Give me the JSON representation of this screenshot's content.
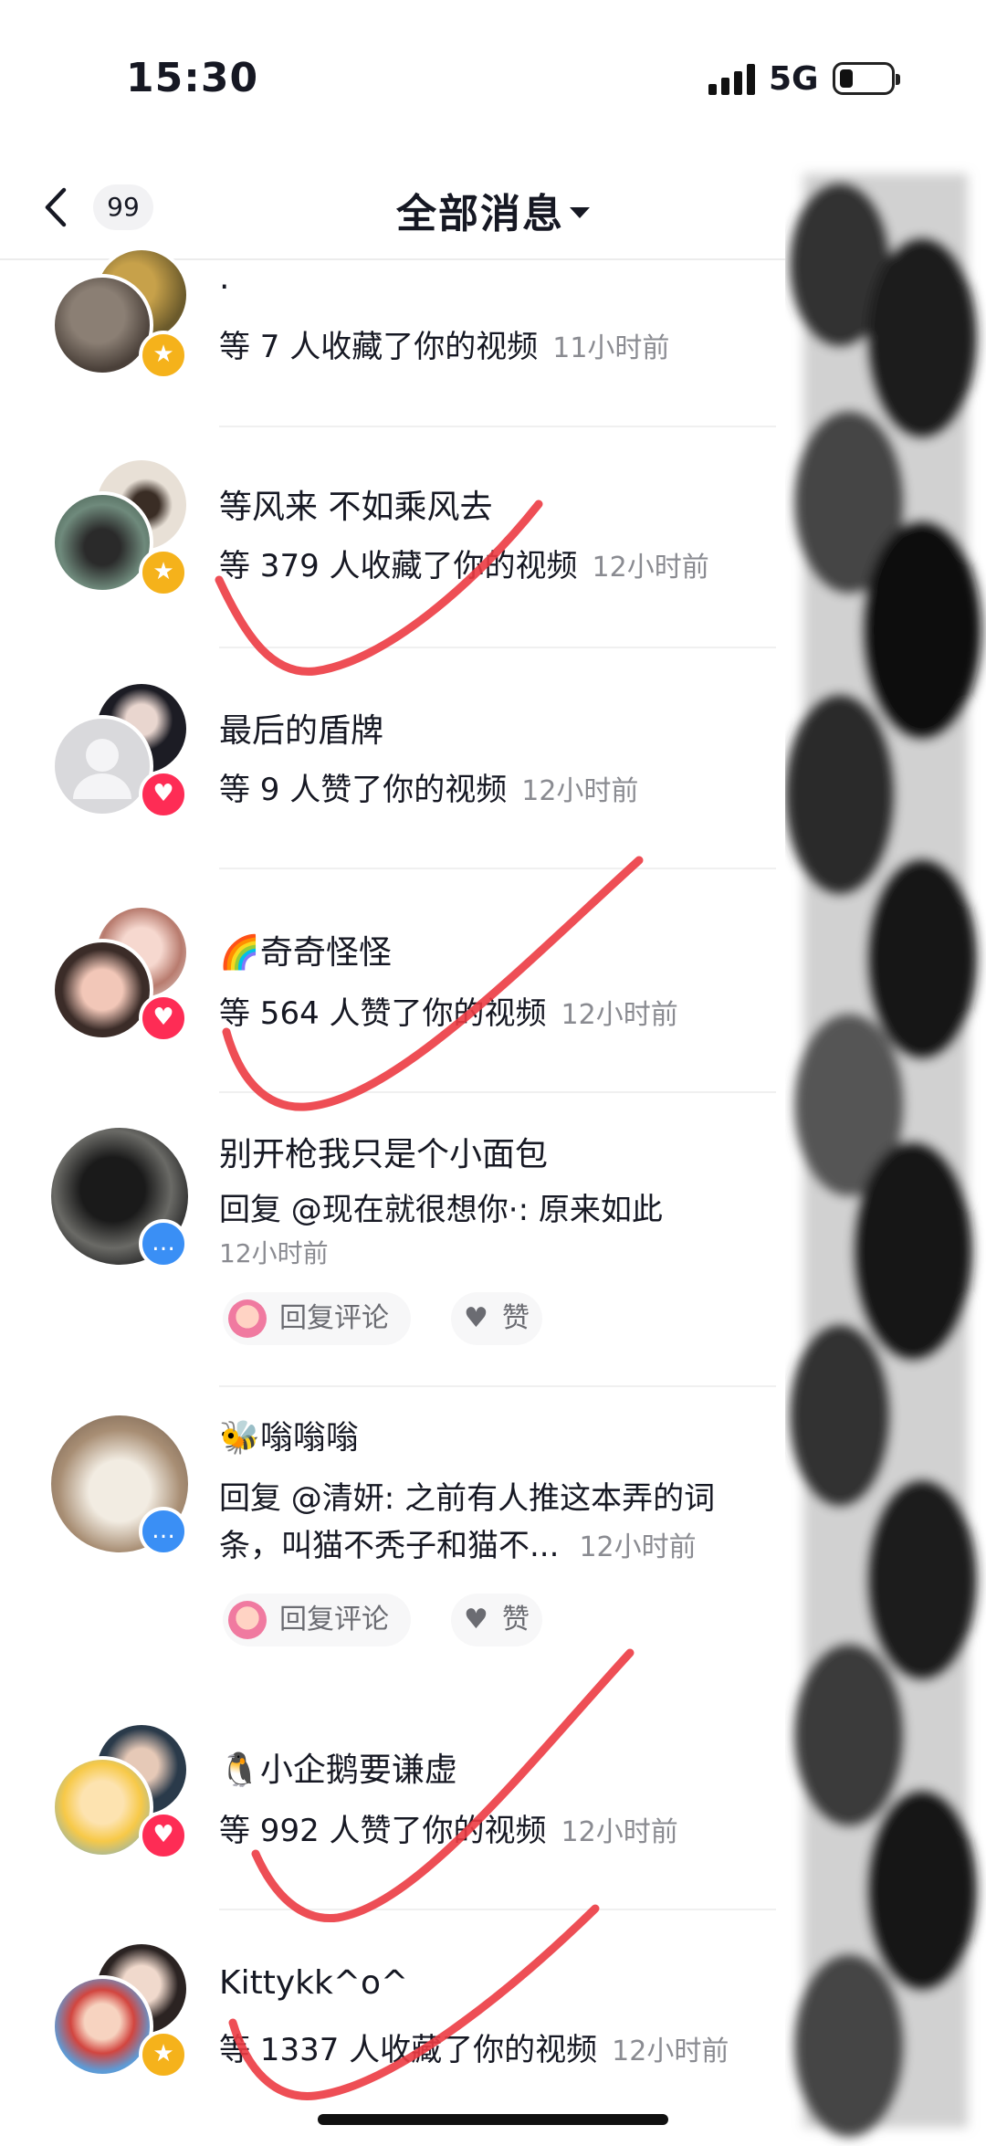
{
  "status_bar": {
    "time": "15:30",
    "network": "5G"
  },
  "header": {
    "badge_count": "99",
    "title": "全部消息"
  },
  "notifications": [
    {
      "name": "·",
      "desc": "等 7 人收藏了你的视频",
      "time": "11小时前",
      "badge": "star-icon"
    },
    {
      "name": "等风来 不如乘风去",
      "desc": "等 379 人收藏了你的视频",
      "time": "12小时前",
      "badge": "star-icon"
    },
    {
      "name": "最后的盾牌",
      "desc": "等 9 人赞了你的视频",
      "time": "12小时前",
      "badge": "heart-icon"
    },
    {
      "emoji": "🌈",
      "name": "奇奇怪怪",
      "desc": "等 564 人赞了你的视频",
      "time": "12小时前",
      "badge": "heart-icon"
    },
    {
      "name": "别开枪我只是个小面包",
      "desc": "回复 @现在就很想你·: 原来如此",
      "time": "12小时前",
      "badge": "comment-icon",
      "reply_label": "回复评论",
      "like_label": "赞"
    },
    {
      "emoji": "🐝",
      "name": "嗡嗡嗡",
      "desc_line1": "回复 @清妍: 之前有人推这本弄的词",
      "desc_line2": "条，叫猫不秃子和猫不...",
      "time": "12小时前",
      "badge": "comment-icon",
      "reply_label": "回复评论",
      "like_label": "赞"
    },
    {
      "emoji": "🐧",
      "name": "小企鹅要谦虚",
      "desc": "等 992 人赞了你的视频",
      "time": "12小时前",
      "badge": "heart-icon"
    },
    {
      "name": "Kittykk^o^",
      "desc": "等 1337 人收藏了你的视频",
      "time": "12小时前",
      "badge": "star-icon"
    }
  ],
  "colors": {
    "like": "#fe2c55",
    "favorite": "#f5b21b",
    "comment": "#3a8ff5",
    "check_mark": "#ec3b43"
  }
}
